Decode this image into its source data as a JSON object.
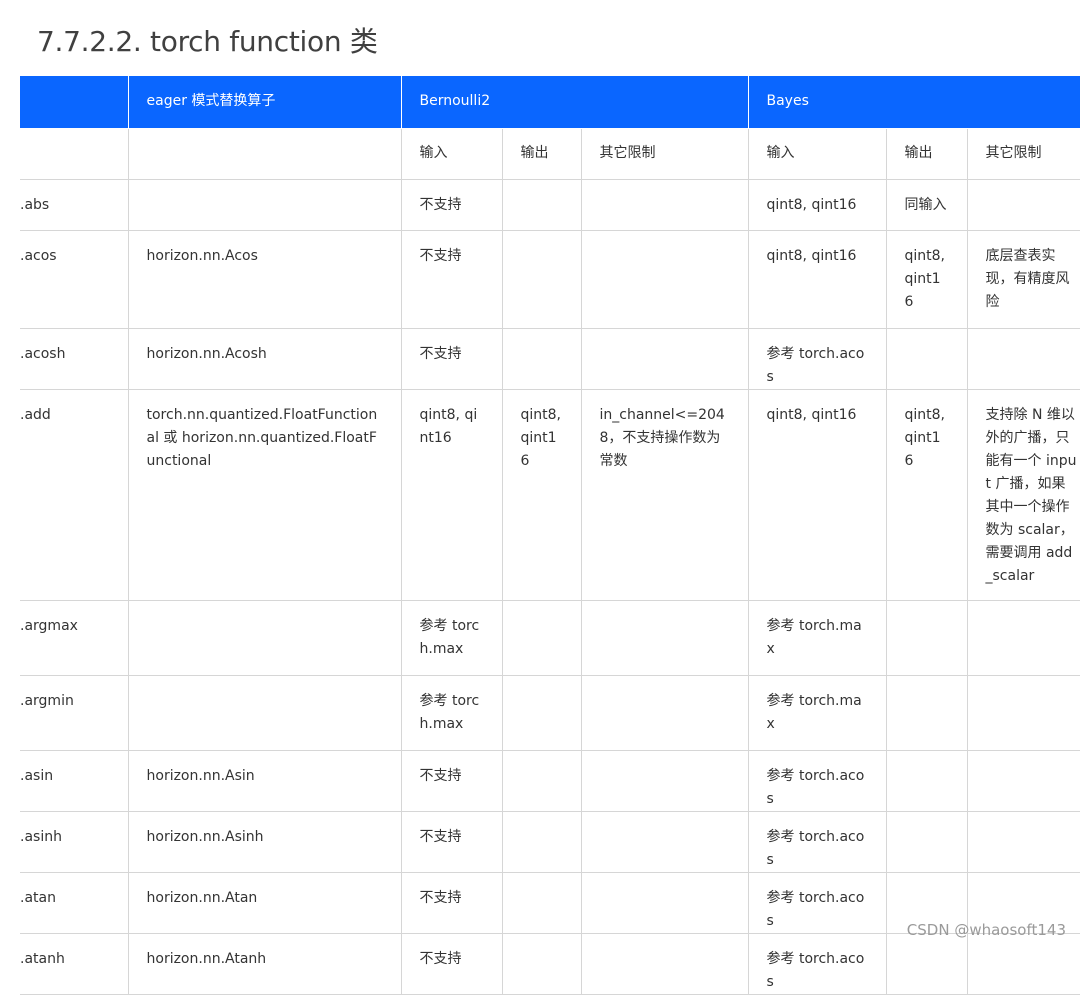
{
  "title": "7.7.2.2. torch function 类",
  "header": {
    "col0": "",
    "eager": "eager 模式替换算子",
    "bernoulli": "Bernoulli2",
    "bayes": "Bayes"
  },
  "subheader": {
    "b_input": "输入",
    "b_output": "输出",
    "b_limit": "其它限制",
    "y_input": "输入",
    "y_output": "输出",
    "y_limit": "其它限制"
  },
  "rows": [
    {
      "name": ".abs",
      "eager": "",
      "b_in": "不支持",
      "b_out": "",
      "b_lim": "",
      "y_in": "qint8, qint16",
      "y_out": "同输入",
      "y_lim": ""
    },
    {
      "name": ".acos",
      "eager": "horizon.nn.Acos",
      "b_in": "不支持",
      "b_out": "",
      "b_lim": "",
      "y_in": "qint8, qint16",
      "y_out": "qint8, qint16",
      "y_lim": "底层查表实现，有精度风险"
    },
    {
      "name": ".acosh",
      "eager": "horizon.nn.Acosh",
      "b_in": "不支持",
      "b_out": "",
      "b_lim": "",
      "y_in": "参考 torch.acos",
      "y_out": "",
      "y_lim": ""
    },
    {
      "name": ".add",
      "eager": "torch.nn.quantized.FloatFunctional 或 horizon.nn.quantized.FloatFunctional",
      "b_in": "qint8, qint16",
      "b_out": "qint8, qint16",
      "b_lim": "in_channel<=2048，不支持操作数为常数",
      "y_in": "qint8, qint16",
      "y_out": "qint8, qint16",
      "y_lim": "支持除 N 维以外的广播，只能有一个 input 广播，如果其中一个操作数为 scalar，需要调用 add_scalar"
    },
    {
      "name": ".argmax",
      "eager": "",
      "b_in": "参考 torch.max",
      "b_out": "",
      "b_lim": "",
      "y_in": "参考 torch.max",
      "y_out": "",
      "y_lim": ""
    },
    {
      "name": ".argmin",
      "eager": "",
      "b_in": "参考 torch.max",
      "b_out": "",
      "b_lim": "",
      "y_in": "参考 torch.max",
      "y_out": "",
      "y_lim": ""
    },
    {
      "name": ".asin",
      "eager": "horizon.nn.Asin",
      "b_in": "不支持",
      "b_out": "",
      "b_lim": "",
      "y_in": "参考 torch.acos",
      "y_out": "",
      "y_lim": ""
    },
    {
      "name": ".asinh",
      "eager": "horizon.nn.Asinh",
      "b_in": "不支持",
      "b_out": "",
      "b_lim": "",
      "y_in": "参考 torch.acos",
      "y_out": "",
      "y_lim": ""
    },
    {
      "name": ".atan",
      "eager": "horizon.nn.Atan",
      "b_in": "不支持",
      "b_out": "",
      "b_lim": "",
      "y_in": "参考 torch.acos",
      "y_out": "",
      "y_lim": ""
    },
    {
      "name": ".atanh",
      "eager": "horizon.nn.Atanh",
      "b_in": "不支持",
      "b_out": "",
      "b_lim": "",
      "y_in": "参考 torch.acos",
      "y_out": "",
      "y_lim": ""
    }
  ],
  "watermark": "CSDN @whaosoft143"
}
